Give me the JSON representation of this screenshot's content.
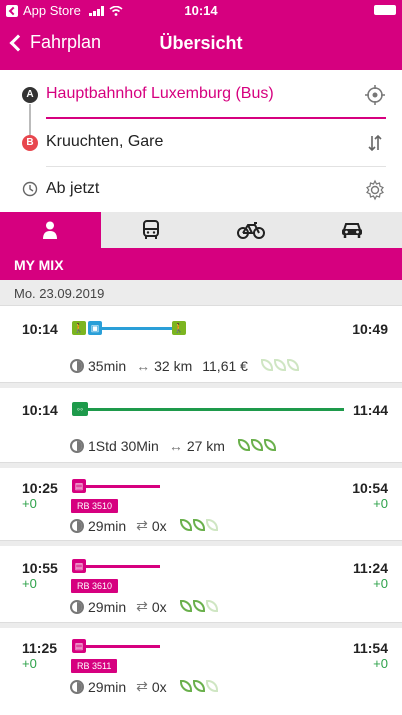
{
  "status_bar": {
    "carrier": "App Store",
    "time": "10:14"
  },
  "nav": {
    "back_label": "Fahrplan",
    "title": "Übersicht"
  },
  "search": {
    "from_badge": "A",
    "from": "Hauptbahnhof Luxemburg (Bus)",
    "to_badge": "B",
    "to": "Kruuchten, Gare",
    "time_option": "Ab jetzt"
  },
  "tabs": [
    {
      "icon": "person-icon",
      "active": true
    },
    {
      "icon": "bus-icon",
      "active": false
    },
    {
      "icon": "bicycle-icon",
      "active": false
    },
    {
      "icon": "car-icon",
      "active": false
    }
  ],
  "section_title": "MY MIX",
  "date": "Mo. 23.09.2019",
  "connections": [
    {
      "departure": "10:14",
      "arrival": "10:49",
      "duration": "35min",
      "distance": "32 km",
      "price": "11,61 €",
      "eco_leaves_filled": 0,
      "eco_leaves_total": 3
    },
    {
      "departure": "10:14",
      "arrival": "11:44",
      "duration": "1Std 30Min",
      "distance": "27 km",
      "eco_leaves_filled": 3,
      "eco_leaves_total": 3
    },
    {
      "departure": "10:25",
      "arrival": "10:54",
      "dep_delay": "+0",
      "arr_delay": "+0",
      "train": "RB 3510",
      "duration": "29min",
      "transfers": "0x",
      "eco_leaves_filled": 2,
      "eco_leaves_total": 3
    },
    {
      "departure": "10:55",
      "arrival": "11:24",
      "dep_delay": "+0",
      "arr_delay": "+0",
      "train": "RB 3610",
      "duration": "29min",
      "transfers": "0x",
      "eco_leaves_filled": 2,
      "eco_leaves_total": 3
    },
    {
      "departure": "11:25",
      "arrival": "11:54",
      "dep_delay": "+0",
      "arr_delay": "+0",
      "train": "RB 3511",
      "duration": "29min",
      "transfers": "0x",
      "eco_leaves_filled": 2,
      "eco_leaves_total": 3
    }
  ],
  "colors": {
    "brand": "#d6007f",
    "walk": "#7cb520",
    "bus": "#2a9fd8",
    "bike": "#1e9a4b",
    "eco": "#6ab04c"
  }
}
